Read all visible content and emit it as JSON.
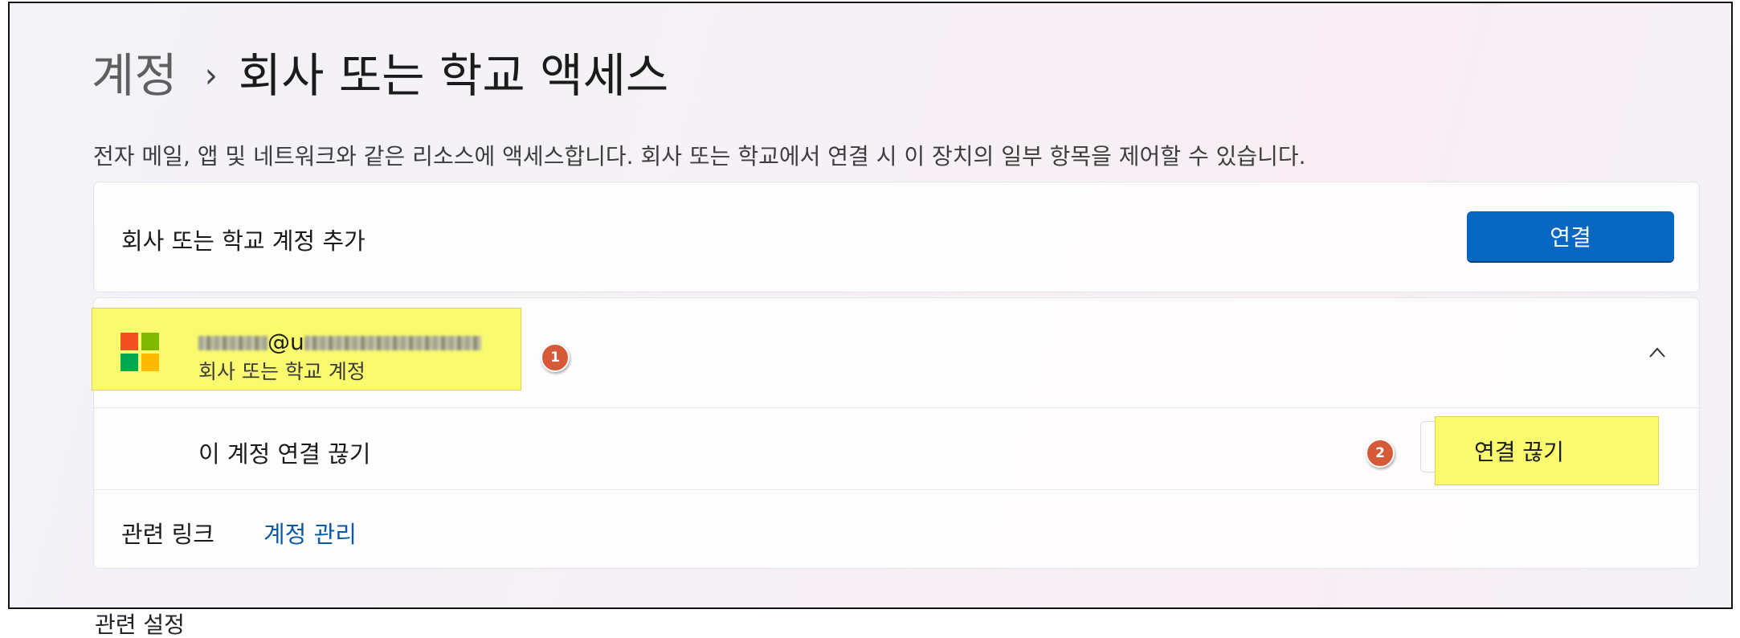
{
  "breadcrumb": {
    "parent": "계정",
    "separator": "›",
    "current": "회사 또는 학교 액세스"
  },
  "description": "전자 메일, 앱 및 네트워크와 같은 리소스에 액세스합니다. 회사 또는 학교에서 연결 시 이 장치의 일부 항목을 제어할 수 있습니다.",
  "add_account": {
    "label": "회사 또는 학교 계정 추가",
    "button_label": "연결"
  },
  "account": {
    "email_visible_part_1": "@u",
    "account_type": "회사 또는 학교 계정",
    "expanded": true,
    "logo": "microsoft-logo",
    "logo_colors": [
      "#f25022",
      "#7fba00",
      "#00a4ef",
      "#ffb900"
    ]
  },
  "disconnect": {
    "label": "이 계정 연결 끊기",
    "button_label": "연결 끊기"
  },
  "related": {
    "label": "관련 링크",
    "link": "계정 관리"
  },
  "annotations": {
    "step_1": "1",
    "step_2": "2",
    "highlight_color": "#fafa6e",
    "badge_color": "#d65a38"
  },
  "below_fold_text": "관련 설정",
  "colors": {
    "accent": "#0867c0",
    "link": "#0c5aa6"
  }
}
